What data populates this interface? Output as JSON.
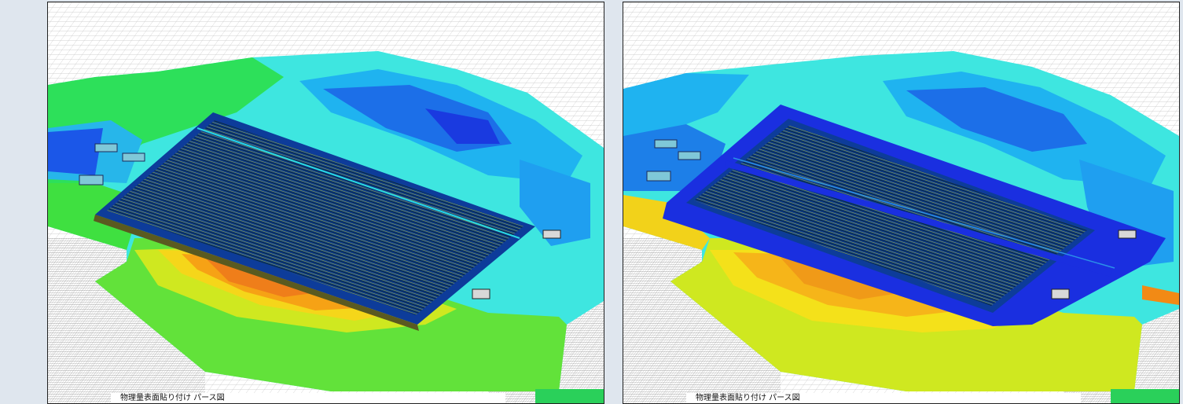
{
  "panels": [
    {
      "caption": "物理量表面貼り付け パース図"
    },
    {
      "caption": "物理量表面貼り付け パース図"
    }
  ]
}
